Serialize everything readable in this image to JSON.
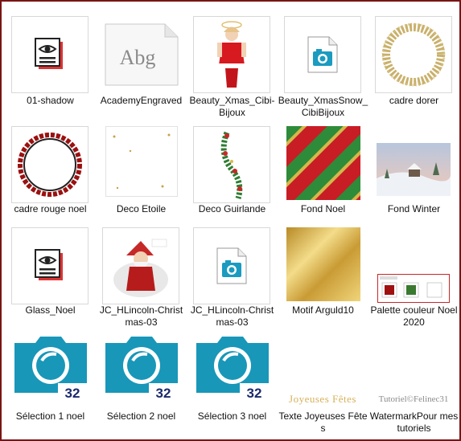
{
  "files": [
    {
      "label": "01-shadow",
      "icon": "document-eye-icon"
    },
    {
      "label": "AcademyEngraved",
      "icon": "font-file-icon",
      "sample": "Abg"
    },
    {
      "label": "Beauty_Xmas_Cibi-Bijoux",
      "icon": "santa-girl-image"
    },
    {
      "label": "Beauty_XmasSnow_CibiBijoux",
      "icon": "photo-file-icon"
    },
    {
      "label": "cadre dorer",
      "icon": "gold-frame-image"
    },
    {
      "label": "cadre rouge noel",
      "icon": "red-frame-image"
    },
    {
      "label": "Deco Etoile",
      "icon": "deco-stars-image"
    },
    {
      "label": "Deco Guirlande",
      "icon": "garland-image"
    },
    {
      "label": "Fond Noel",
      "icon": "striped-background-image"
    },
    {
      "label": "Fond Winter",
      "icon": "winter-landscape-image"
    },
    {
      "label": "Glass_Noel",
      "icon": "document-eye-icon"
    },
    {
      "label": "JC_HLincoln-Christmas-03",
      "icon": "santa-claus-image"
    },
    {
      "label": "JC_HLincoln-Christmas-03",
      "icon": "photo-file-icon"
    },
    {
      "label": "Motif Arguld10",
      "icon": "gold-gradient-image"
    },
    {
      "label": "Palette couleur Noel 2020",
      "icon": "color-palette-image"
    },
    {
      "label": "Sélection 1 noel",
      "icon": "selection-icon",
      "badge": "32"
    },
    {
      "label": "Sélection 2 noel",
      "icon": "selection-icon",
      "badge": "32"
    },
    {
      "label": "Sélection 3 noel",
      "icon": "selection-icon",
      "badge": "32"
    },
    {
      "label": "Texte Joyeuses Fêtes",
      "icon": "text-image",
      "thumb_text": "Joyeuses Fêtes"
    },
    {
      "label": "WatermarkPour mes tutoriels",
      "icon": "watermark-image",
      "thumb_text": "Tutoriel©Felinec31"
    }
  ]
}
